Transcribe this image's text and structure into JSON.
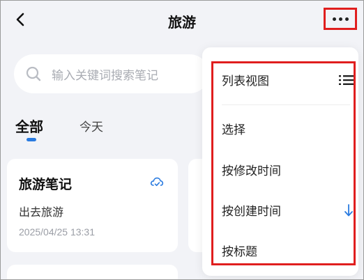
{
  "header": {
    "title": "旅游"
  },
  "search": {
    "placeholder": "输入关键词搜索笔记"
  },
  "tabs": [
    {
      "label": "全部",
      "active": true
    },
    {
      "label": "今天",
      "active": false
    }
  ],
  "notes": [
    {
      "title": "旅游笔记",
      "description": "出去旅游",
      "date": "2025/04/25 13:31",
      "sync_icon": "cloud-sync-icon"
    }
  ],
  "menu": {
    "items": [
      {
        "label": "列表视图",
        "icon": "list-icon"
      },
      {
        "label": "选择"
      },
      {
        "label": "按修改时间"
      },
      {
        "label": "按创建时间",
        "icon": "arrow-down-icon",
        "selected": true
      },
      {
        "label": "按标题"
      }
    ]
  },
  "colors": {
    "accent": "#2a7be0",
    "highlight_box": "#e01e1e",
    "background": "#f2f3f7",
    "card": "#ffffff"
  }
}
